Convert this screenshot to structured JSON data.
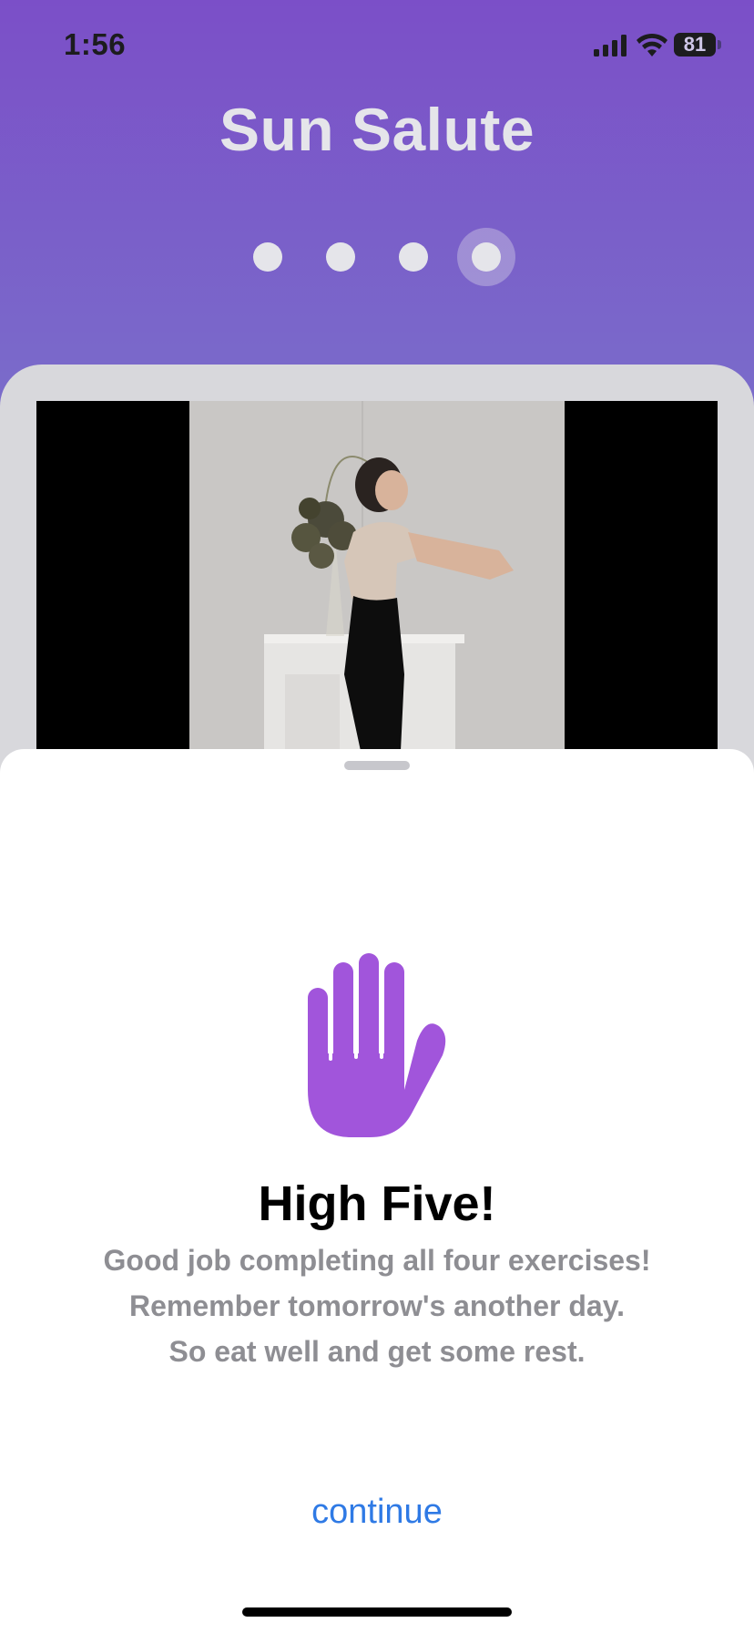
{
  "status_bar": {
    "time": "1:56",
    "battery_percent": "81",
    "signal_icon": "cellular-signal-icon",
    "wifi_icon": "wifi-icon",
    "battery_icon": "battery-icon"
  },
  "header": {
    "title": "Sun Salute"
  },
  "pager": {
    "count": 4,
    "active_index": 3
  },
  "video": {
    "description_icon": "video-player"
  },
  "sheet": {
    "icon": "raised-hand-icon",
    "icon_color": "#a155db",
    "headline": "High Five!",
    "message_lines": [
      "Good job completing all four exercises!",
      "Remember tomorrow's another day.",
      "So eat well and get some rest."
    ],
    "continue_label": "continue",
    "link_color": "#2f7ae5"
  }
}
